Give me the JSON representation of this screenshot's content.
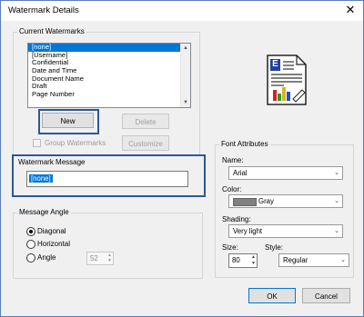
{
  "title": "Watermark Details",
  "close_glyph": "✕",
  "current": {
    "group_label": "Current Watermarks",
    "items": [
      "[none]",
      "[Username]",
      "Confidential",
      "Date and Time",
      "Document Name",
      "Draft",
      "Page Number"
    ],
    "selected_index": 0
  },
  "buttons": {
    "new": "New",
    "delete": "Delete",
    "customize": "Customize",
    "ok": "OK",
    "cancel": "Cancel"
  },
  "group_watermarks_label": "Group Watermarks",
  "message": {
    "group_label": "Watermark Message",
    "value": "[none]"
  },
  "angle": {
    "group_label": "Message Angle",
    "options": [
      "Diagonal",
      "Horizontal",
      "Angle"
    ],
    "selected": "Diagonal",
    "angle_value": "52"
  },
  "font": {
    "group_label": "Font Attributes",
    "name_label": "Name:",
    "name_value": "Arial",
    "color_label": "Color:",
    "color_value": "Gray",
    "color_swatch": "#808080",
    "shading_label": "Shading:",
    "shading_value": "Very light",
    "size_label": "Size:",
    "size_value": "80",
    "style_label": "Style:",
    "style_value": "Regular"
  },
  "preview_letter": "E",
  "colors": {
    "accent": "#0078d7",
    "highlight_border": "#2b579a"
  }
}
